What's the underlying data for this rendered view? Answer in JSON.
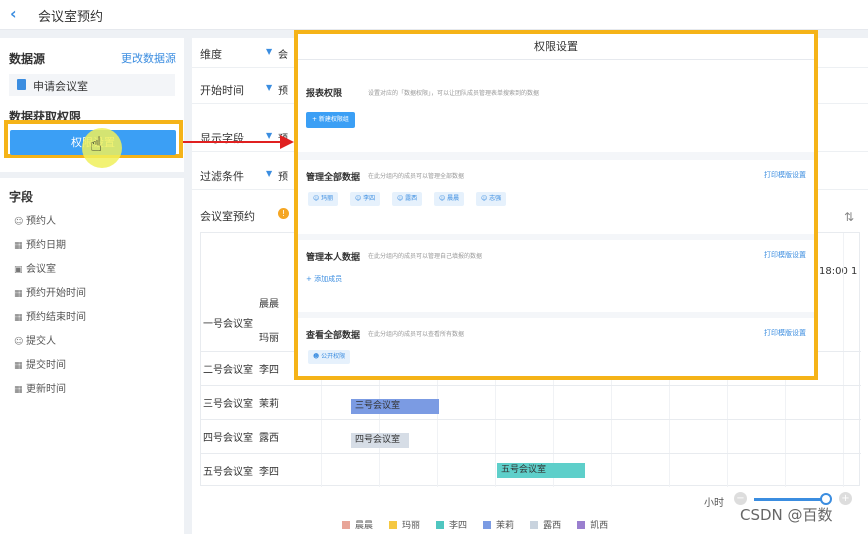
{
  "header": {
    "back_icon": "chevron-left-icon",
    "title": "会议室预约"
  },
  "datasource": {
    "title": "数据源",
    "change_link": "更改数据源",
    "item_label": "申请会议室",
    "item_icon": "document-icon"
  },
  "permission": {
    "title": "数据获取权限",
    "button_label": "权限设置"
  },
  "fields": {
    "title": "字段",
    "items": [
      {
        "label": "预约人",
        "icon": "person-icon"
      },
      {
        "label": "预约日期",
        "icon": "calendar-icon"
      },
      {
        "label": "会议室",
        "icon": "box-icon"
      },
      {
        "label": "预约开始时间",
        "icon": "calendar-icon"
      },
      {
        "label": "预约结束时间",
        "icon": "calendar-icon"
      },
      {
        "label": "提交人",
        "icon": "person-icon"
      },
      {
        "label": "提交时间",
        "icon": "calendar-icon"
      },
      {
        "label": "更新时间",
        "icon": "calendar-icon"
      }
    ]
  },
  "config": {
    "rows": [
      {
        "label": "维度",
        "value": "会"
      },
      {
        "label": "开始时间",
        "value": "预"
      },
      {
        "label": "显示字段",
        "value": "预"
      },
      {
        "label": "过滤条件",
        "value": "预"
      }
    ]
  },
  "schedule": {
    "title": "会议室预约",
    "time_label": "18:00 1",
    "rooms": [
      {
        "name": "一号会议室",
        "people": [
          "晨晨",
          "玛丽"
        ]
      },
      {
        "name": "二号会议室",
        "people": [
          "李四"
        ]
      },
      {
        "name": "三号会议室",
        "people": [
          "茉莉"
        ]
      },
      {
        "name": "四号会议室",
        "people": [
          "露西"
        ]
      },
      {
        "name": "五号会议室",
        "people": [
          "李四"
        ]
      }
    ],
    "bookings": [
      {
        "label": "三号会议室",
        "color": "#7b9be3"
      },
      {
        "label": "四号会议室",
        "color": "#d6dde6"
      },
      {
        "label": "五号会议室",
        "color": "#5ecfca"
      }
    ],
    "zoom_label": "小时",
    "zoom_level": 1.0
  },
  "legend": [
    {
      "name": "晨晨",
      "color": "#e8a598"
    },
    {
      "name": "玛丽",
      "color": "#f5c842"
    },
    {
      "name": "李四",
      "color": "#4fc6c0"
    },
    {
      "name": "茉莉",
      "color": "#7b9be3"
    },
    {
      "name": "露西",
      "color": "#c9d3de"
    },
    {
      "name": "凯西",
      "color": "#9a7fcf"
    }
  ],
  "watermark": "CSDN @百数",
  "modal": {
    "title": "权限设置",
    "report": {
      "title": "报表权限",
      "desc": "设置对应的「数据权限」，可以让团队成员管理表单搜索到的数据",
      "new_button": "+ 新建权限组"
    },
    "manage_all": {
      "title": "管理全部数据",
      "desc": "在此分组内的成员可以管理全部数据",
      "link": "打印模版设置",
      "members": [
        "玛丽",
        "李四",
        "露西",
        "晨晨",
        "志强"
      ]
    },
    "manage_own": {
      "title": "管理本人数据",
      "desc": "在此分组内的成员可以管理自己填报的数据",
      "link": "打印模版设置",
      "add_label": "添加成员"
    },
    "view_all": {
      "title": "查看全部数据",
      "desc": "在此分组内的成员可以查看所有数据",
      "link": "打印模版设置",
      "chip": "公开权限"
    }
  },
  "colors": {
    "accent": "#3b8de0",
    "highlight": "#f5b318",
    "arrow": "#e02020"
  }
}
